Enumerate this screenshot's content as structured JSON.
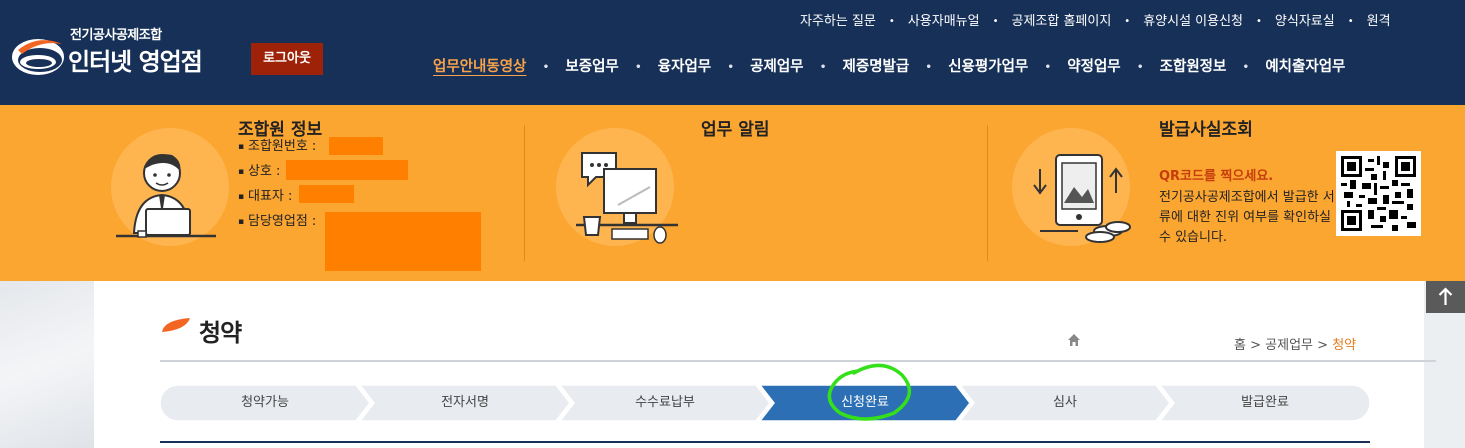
{
  "header": {
    "logo_small": "전기공사공제조합",
    "logo_big": "인터넷 영업점",
    "logout_label": "로그아웃",
    "util_links": [
      "자주하는 질문",
      "사용자매뉴얼",
      "공제조합 홈페이지",
      "휴양시설 이용신청",
      "양식자료실",
      "원격"
    ],
    "nav": [
      {
        "label": "업무안내동영상",
        "active": true
      },
      {
        "label": "보증업무",
        "active": false
      },
      {
        "label": "융자업무",
        "active": false
      },
      {
        "label": "공제업무",
        "active": false
      },
      {
        "label": "제증명발급",
        "active": false
      },
      {
        "label": "신용평가업무",
        "active": false
      },
      {
        "label": "약정업무",
        "active": false
      },
      {
        "label": "조합원정보",
        "active": false
      },
      {
        "label": "예치출자업무",
        "active": false
      }
    ],
    "bullet": "•"
  },
  "info_band": {
    "member_title": "조합원 정보",
    "member_fields": [
      {
        "label": "조합원번호 :"
      },
      {
        "label": "상호 :"
      },
      {
        "label": "대표자 :"
      },
      {
        "label": "담당영업점 :"
      }
    ],
    "notice_title": "업무 알림",
    "verify_title": "발급사실조회",
    "qr_title": "QR코드를 찍으세요.",
    "qr_desc": "전기공사공제조합에서 발급한 서류에 대한 진위 여부를 확인하실 수 있습니다.",
    "field_bullet": "▪"
  },
  "page": {
    "title": "청약",
    "breadcrumb": {
      "home": "홈",
      "sep": ">",
      "section": "공제업무",
      "current": "청약"
    }
  },
  "steps": [
    {
      "label": "청약가능",
      "active": false
    },
    {
      "label": "전자서명",
      "active": false
    },
    {
      "label": "수수료납부",
      "active": false
    },
    {
      "label": "신청완료",
      "active": true
    },
    {
      "label": "심사",
      "active": false
    },
    {
      "label": "발급완료",
      "active": false
    }
  ],
  "colors": {
    "header_bg": "#173058",
    "band_bg": "#fca632",
    "step_active": "#2d6fb5",
    "step_inactive": "#e8ebf0",
    "highlight_circle": "#33e01a",
    "accent_orange": "#f5a24a"
  },
  "icons": [
    "logo-mark-icon",
    "member-illustration-icon",
    "notice-illustration-icon",
    "verify-illustration-icon",
    "qr-code-icon",
    "home-icon",
    "arrow-up-icon"
  ]
}
